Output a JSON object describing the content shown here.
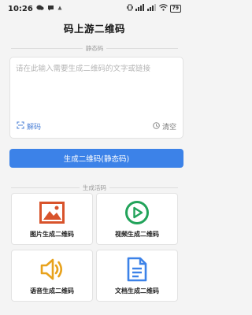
{
  "status": {
    "time": "10:26",
    "battery": "79"
  },
  "app": {
    "title": "码上游二维码"
  },
  "static_section": {
    "title": "静态码",
    "placeholder": "请在此输入需要生成二维码的文字或链接",
    "decode_label": "解码",
    "clear_label": "清空",
    "generate_label": "生成二维码(静态码)"
  },
  "live_section": {
    "title": "生成活码",
    "tiles": [
      {
        "label": "图片生成二维码",
        "icon": "image-icon",
        "color": "#d8532b"
      },
      {
        "label": "视频生成二维码",
        "icon": "video-play-icon",
        "color": "#22a35a"
      },
      {
        "label": "语音生成二维码",
        "icon": "speaker-icon",
        "color": "#e8a21c"
      },
      {
        "label": "文档生成二维码",
        "icon": "document-icon",
        "color": "#3c82e8"
      }
    ]
  },
  "colors": {
    "primary": "#3c82e8",
    "link": "#4a7fd6",
    "background": "#f4f4f4"
  }
}
